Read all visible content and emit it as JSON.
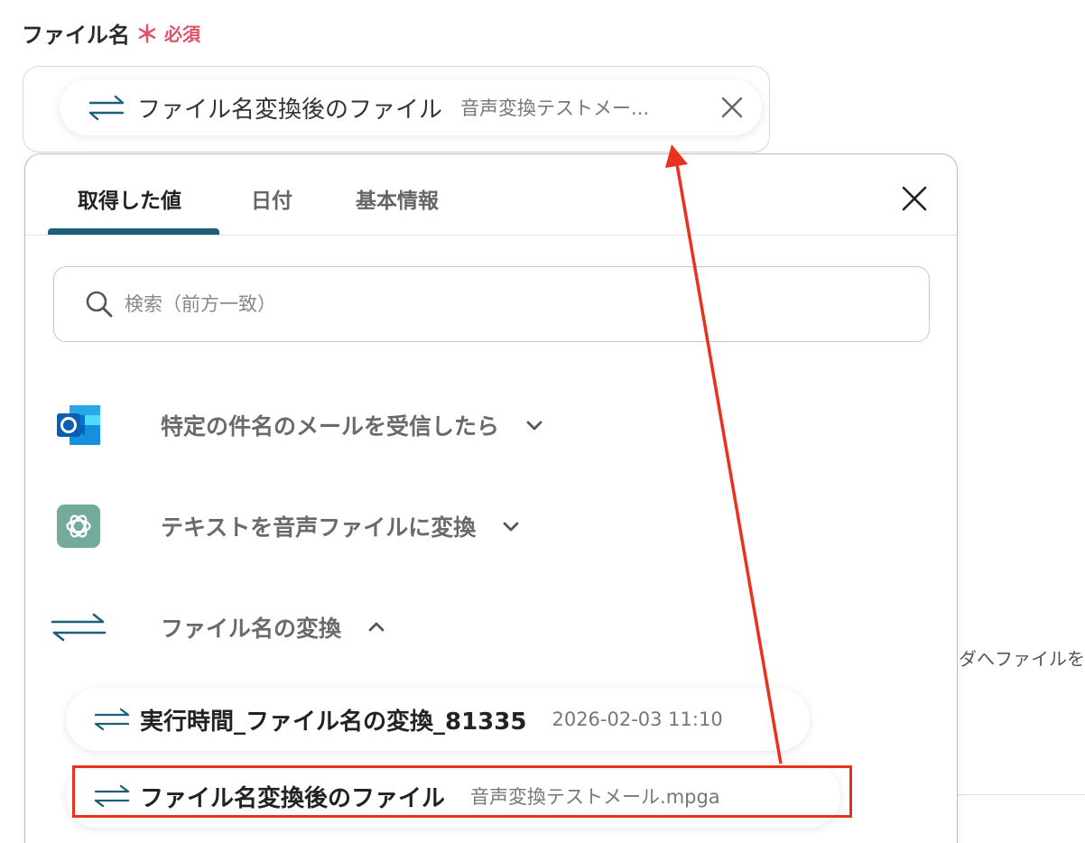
{
  "field": {
    "label": "ファイル名",
    "required_mark": "＊",
    "required_text": "必須"
  },
  "selected_chip": {
    "label": "ファイル名変換後のファイル",
    "value": "音声変換テストメー..."
  },
  "tabs": [
    {
      "label": "取得した値",
      "active": true
    },
    {
      "label": "日付",
      "active": false
    },
    {
      "label": "基本情報",
      "active": false
    }
  ],
  "search": {
    "placeholder": "検索（前方一致）",
    "value": ""
  },
  "groups": [
    {
      "label": "特定の件名のメールを受信したら",
      "icon": "outlook-icon",
      "expanded": false
    },
    {
      "label": "テキストを音声ファイルに変換",
      "icon": "chatgpt-icon",
      "expanded": false
    },
    {
      "label": "ファイル名の変換",
      "icon": "swap-arrows-icon",
      "expanded": true
    }
  ],
  "items": [
    {
      "label": "実行時間_ファイル名の変換_81335",
      "value": "2026-02-03 11:10"
    },
    {
      "label": "ファイル名変換後のファイル",
      "value": "音声変換テストメール.mpga"
    }
  ],
  "background": {
    "side_text": "ダへファイルを格"
  },
  "colors": {
    "required": "#e0506a",
    "tab_indicator": "#1c5f7c",
    "annotation": "#e8321e",
    "swap_icon": "#1c5f7c"
  }
}
